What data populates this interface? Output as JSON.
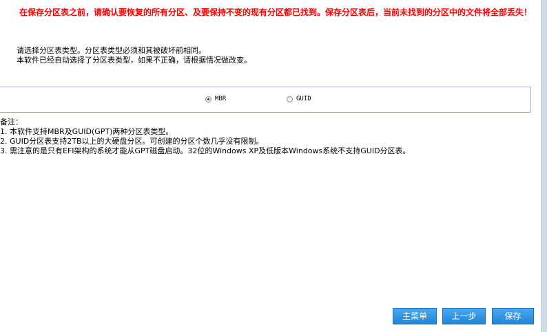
{
  "warning": "在保存分区表之前，请确认要恢复的所有分区、及要保持不变的现有分区都已找到。保存分区表后，当前未找到的分区中的文件将全部丢失！",
  "instructions": [
    "请选择分区表类型。分区表类型必须和其被破坏前相同。",
    "本软件已经自动选择了分区表类型，如果不正确，请根据情况做改变。"
  ],
  "partition_type": {
    "options": [
      {
        "label": "MBR",
        "selected": true
      },
      {
        "label": "GUID",
        "selected": false
      }
    ]
  },
  "notes": {
    "title": "备注：",
    "items": [
      "1. 本软件支持MBR及GUID(GPT)两种分区表类型。",
      "2. GUID分区表支持2TB以上的大硬盘分区。可创建的分区个数几乎没有限制。",
      "3. 需注意的是只有EFI架构的系统才能从GPT磁盘启动。32位的Windows XP及低版本Windows系统不支持GUID分区表。"
    ]
  },
  "buttons": {
    "main_menu": "主菜单",
    "back": "上一步",
    "save": "保存"
  },
  "colors": {
    "warning": "#ff0000",
    "button": "#2b95e6"
  }
}
